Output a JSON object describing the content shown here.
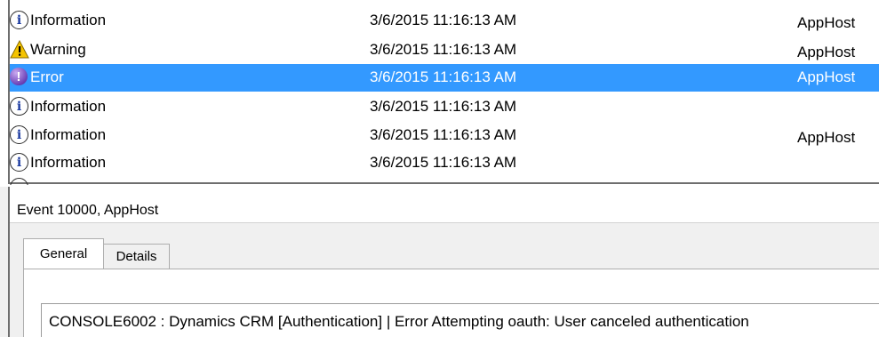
{
  "events": [
    {
      "level": "Information",
      "date": "3/6/2015 11:16:13 AM",
      "source": "AppHost",
      "icon": "info-icon"
    },
    {
      "level": "Warning",
      "date": "3/6/2015 11:16:13 AM",
      "source": "AppHost",
      "icon": "warning-icon"
    },
    {
      "level": "Error",
      "date": "3/6/2015 11:16:13 AM",
      "source": "AppHost",
      "icon": "error-icon",
      "selected": true
    },
    {
      "level": "Information",
      "date": "3/6/2015 11:16:13 AM",
      "source": "",
      "icon": "info-icon"
    },
    {
      "level": "Information",
      "date": "3/6/2015 11:16:13 AM",
      "source": "AppHost",
      "icon": "info-icon"
    },
    {
      "level": "Information",
      "date": "3/6/2015 11:16:13 AM",
      "source": "",
      "icon": "info-icon"
    }
  ],
  "detail": {
    "title": "Event 10000, AppHost",
    "tabs": [
      "General",
      "Details"
    ],
    "message": "CONSOLE6002 : Dynamics CRM [Authentication] | Error Attempting oauth: User canceled authentication"
  },
  "colors": {
    "selection": "#3399ff",
    "warning": "#f5c400",
    "error": "#6a3fb5"
  }
}
